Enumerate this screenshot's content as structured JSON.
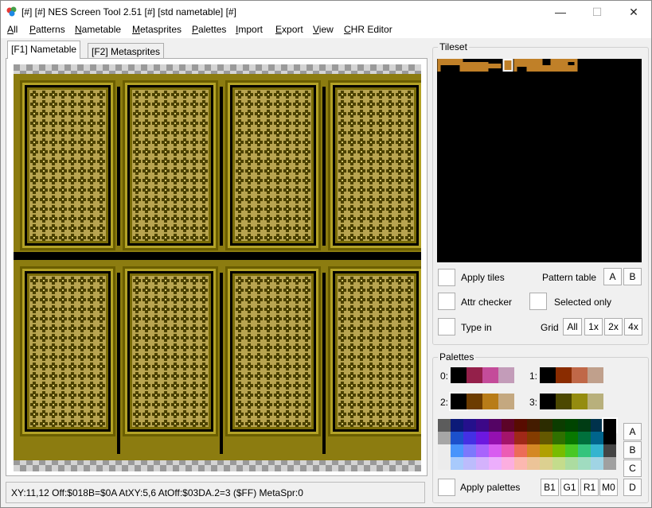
{
  "window": {
    "title": "[#] [#] NES Screen Tool 2.51 [#]  [std nametable] [#]",
    "minimize": "—",
    "maximize": "☐",
    "close": "✕"
  },
  "menu": [
    "All",
    "Patterns",
    "Nametable",
    "Metasprites",
    "Palettes",
    "Import",
    "Export",
    "View",
    "CHR Editor"
  ],
  "tabs": {
    "nametable": "[F1] Nametable",
    "metasprites": "[F2] Metasprites"
  },
  "status": "XY:11,12 Off:$018B=$0A AtXY:5,6 AtOff:$03DA.2=3 ($FF) MetaSpr:0",
  "tileset": {
    "title": "Tileset",
    "apply_tiles": "Apply tiles",
    "pattern_table_label": "Pattern table",
    "pattern_a": "A",
    "pattern_b": "B",
    "attr_checker": "Attr checker",
    "selected_only": "Selected only",
    "type_in": "Type in",
    "grid_label": "Grid",
    "grid_all": "All",
    "grid_1x": "1x",
    "grid_2x": "2x",
    "grid_4x": "4x"
  },
  "palettes": {
    "title": "Palettes",
    "labels": [
      "0:",
      "1:",
      "2:",
      "3:"
    ],
    "sets": [
      [
        "#000000",
        "#94204a",
        "#c44c9a",
        "#c39cb9"
      ],
      [
        "#000000",
        "#8a2c00",
        "#c06848",
        "#c0a08c"
      ],
      [
        "#000000",
        "#6c3c00",
        "#b87c18",
        "#c4a880"
      ],
      [
        "#000000",
        "#4c4800",
        "#948c10",
        "#b8b07c"
      ]
    ],
    "side_buttons": [
      "A",
      "B",
      "C",
      "D"
    ],
    "apply_palettes": "Apply palettes",
    "bottom_buttons": [
      "B1",
      "G1",
      "R1",
      "M0"
    ],
    "master": [
      [
        "#5c5c5c",
        "#0c1a78",
        "#24108c",
        "#3c0888",
        "#540464",
        "#5c0428",
        "#580c00",
        "#441c00",
        "#2c2c00",
        "#0c3c00",
        "#004400",
        "#003c14",
        "#00324c",
        "#000000"
      ],
      [
        "#a6a6a6",
        "#1c50cc",
        "#4430e4",
        "#6c18e0",
        "#9410b0",
        "#a4146a",
        "#a02818",
        "#843c00",
        "#645800",
        "#307000",
        "#087800",
        "#00703c",
        "#00648c",
        "#000000"
      ],
      [
        "#ececec",
        "#4894fc",
        "#7c78fc",
        "#a864fc",
        "#d85cf0",
        "#ec5cb4",
        "#ec6c58",
        "#d48824",
        "#b0a000",
        "#78bc00",
        "#48c824",
        "#34c47c",
        "#34b4d0",
        "#444444"
      ],
      [
        "#ececec",
        "#a8cafc",
        "#bcbcfc",
        "#d4b2fc",
        "#ecaefc",
        "#fcaee0",
        "#fcb8b0",
        "#ecc498",
        "#dcd090",
        "#c4dc8c",
        "#acdca0",
        "#a0dcc0",
        "#a0d4e4",
        "#a0a0a0"
      ]
    ]
  },
  "icons": {
    "app": "nes-screen-tool-icon"
  }
}
